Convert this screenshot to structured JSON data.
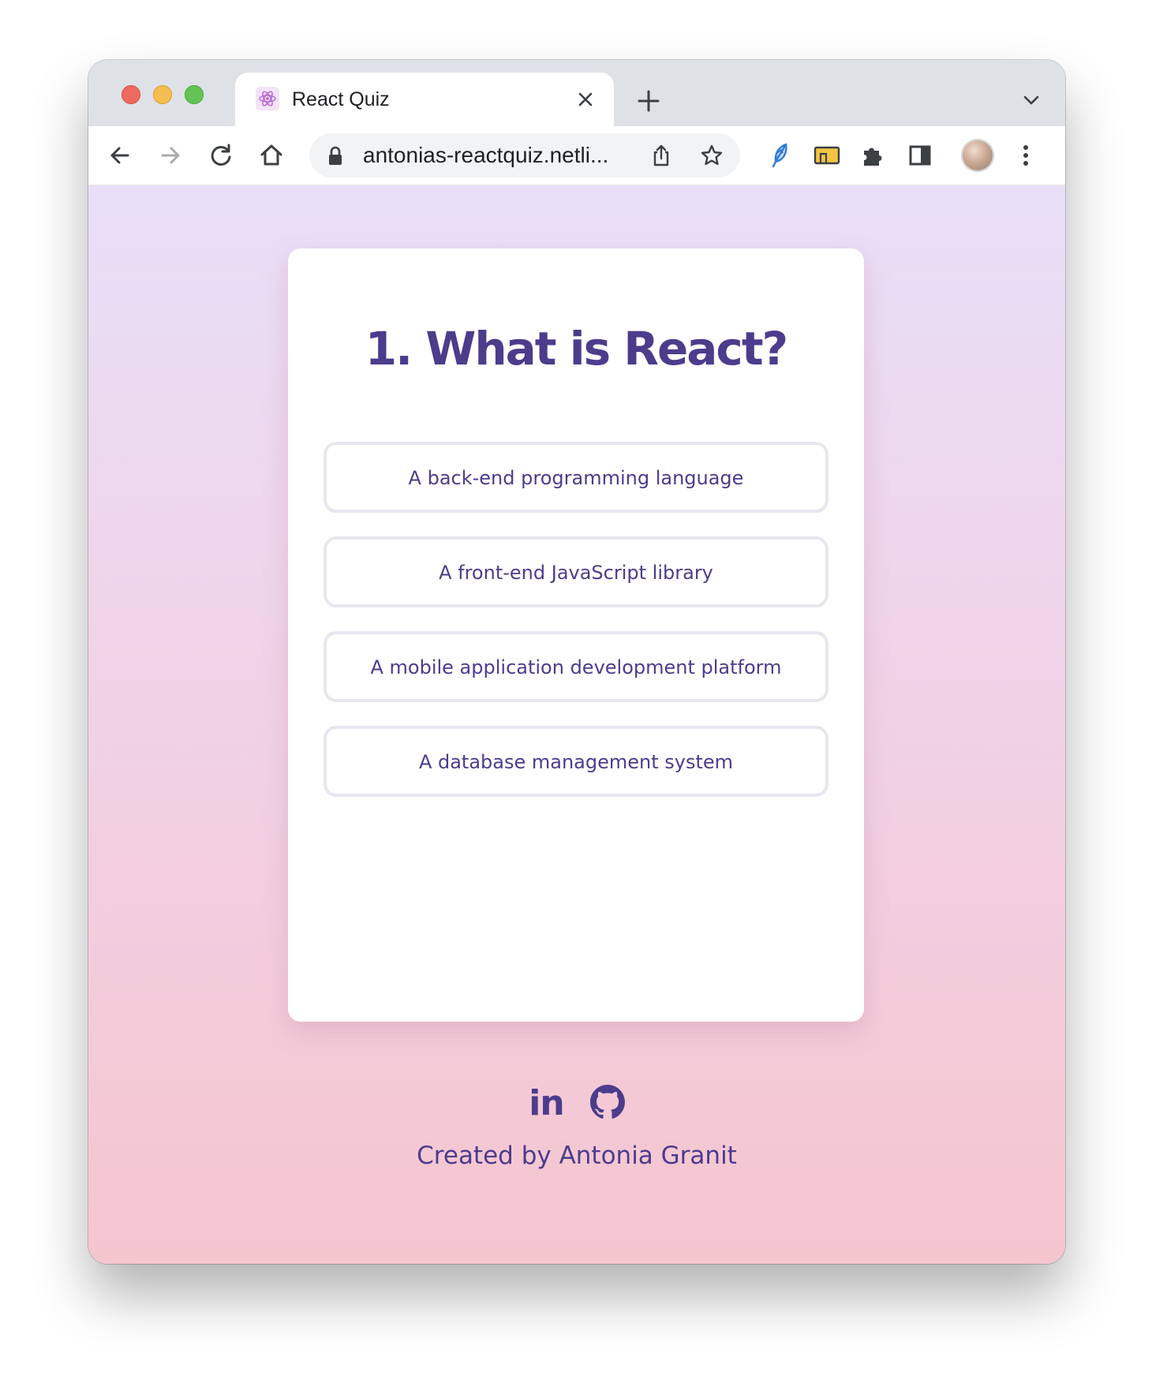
{
  "browser": {
    "tab": {
      "title": "React Quiz",
      "favicon": "react-atom-icon"
    },
    "address_bar": {
      "url": "antonias-reactquiz.netli..."
    },
    "toolbar_icons": [
      "back-arrow-icon",
      "forward-arrow-icon",
      "reload-icon",
      "home-icon",
      "lock-icon",
      "share-icon",
      "bookmark-star-icon",
      "extension-feather-icon",
      "extension-folder-icon",
      "extensions-puzzle-icon",
      "side-panel-icon",
      "profile-avatar",
      "more-menu-icon"
    ]
  },
  "quiz": {
    "question": "1. What is React?",
    "answers": [
      "A back-end programming language",
      "A front-end JavaScript library",
      "A mobile application development platform",
      "A database management system"
    ]
  },
  "footer": {
    "linkedin_label": "in",
    "credit": "Created by Antonia Granit"
  },
  "colors": {
    "accent": "#4c3c8c",
    "answer_border": "#e8e6ef",
    "gradient_top": "#e8dff7",
    "gradient_bottom": "#f5c5ce"
  }
}
